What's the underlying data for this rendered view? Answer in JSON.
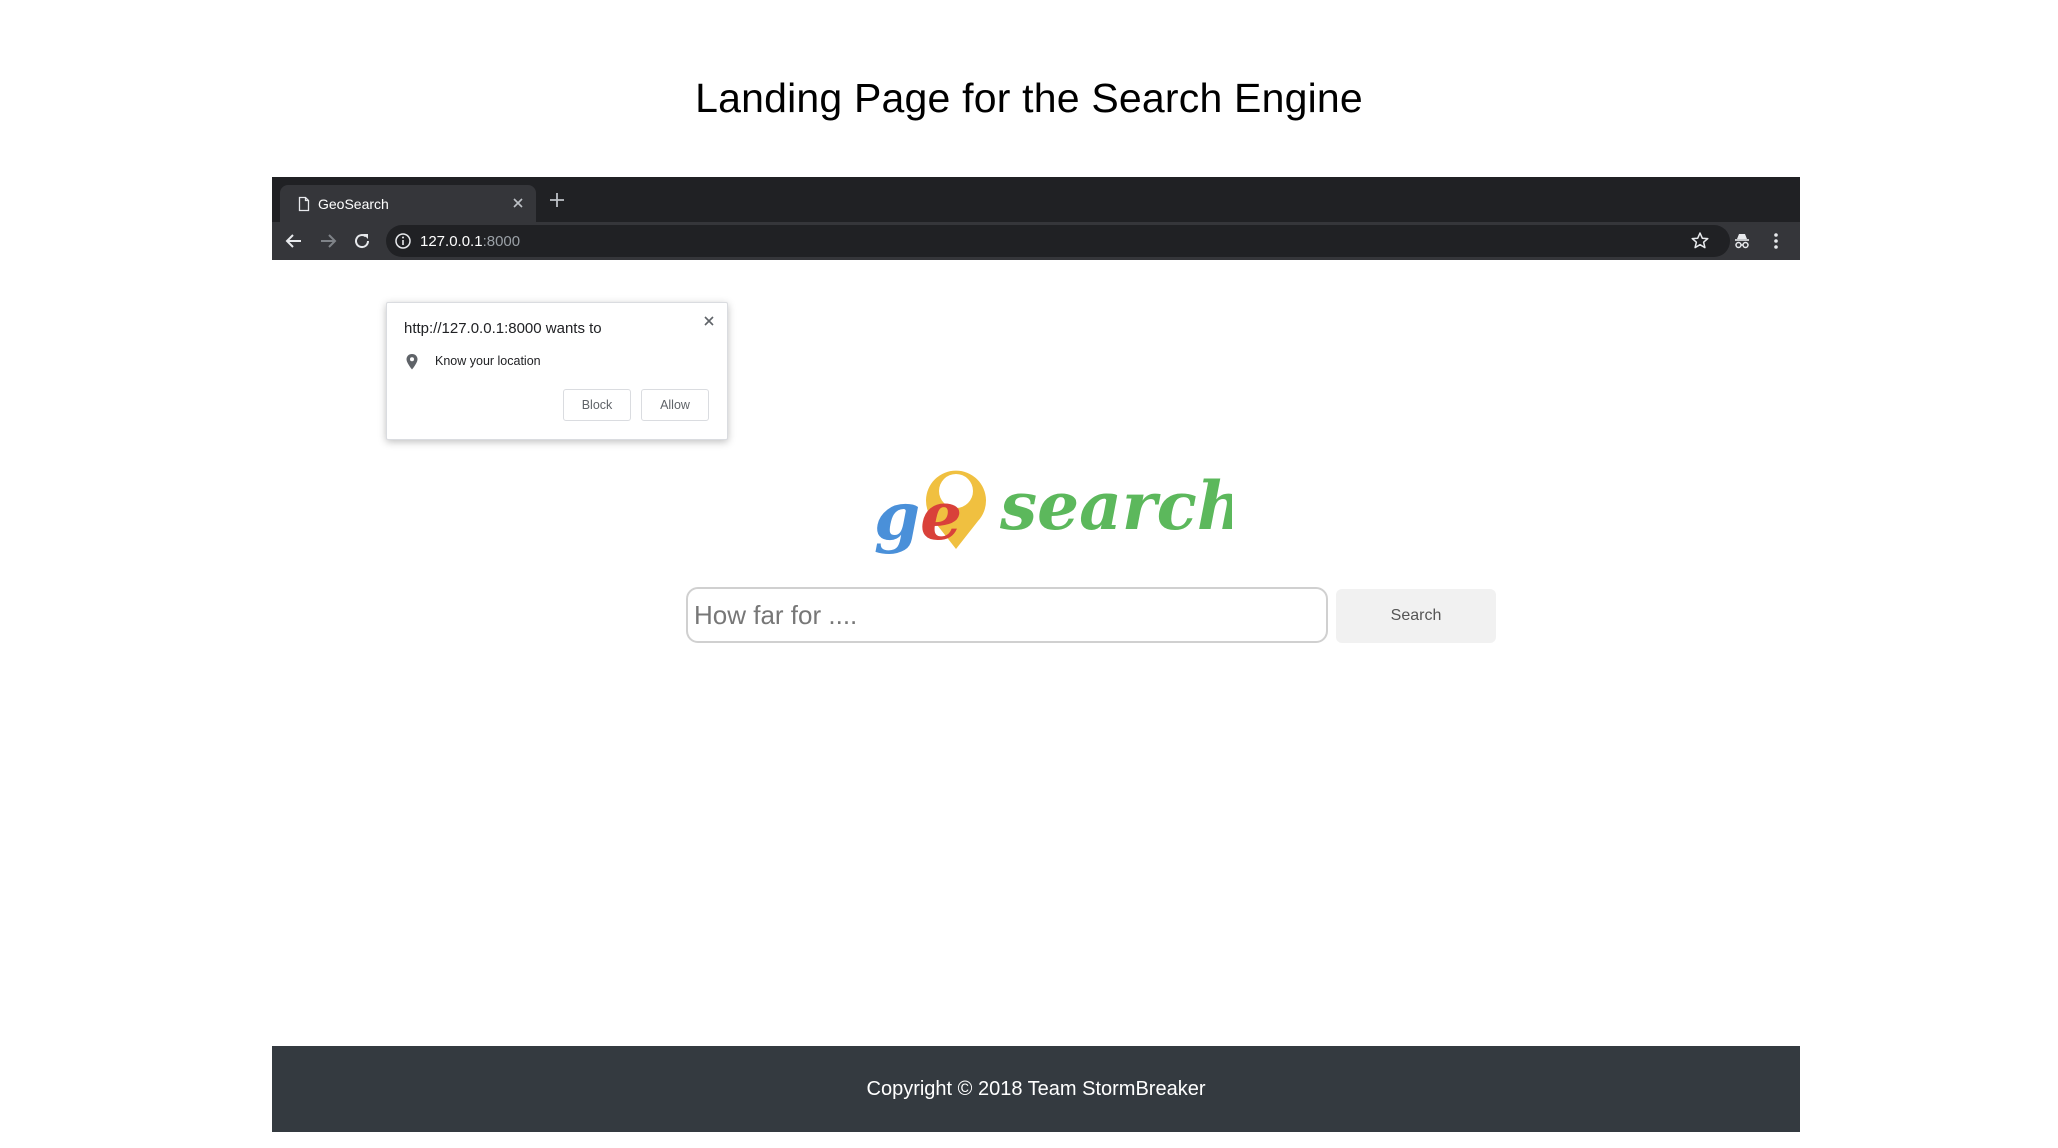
{
  "slide": {
    "title": "Landing Page for the Search Engine"
  },
  "browser": {
    "tab_title": "GeoSearch",
    "url_host": "127.0.0.1",
    "url_port": ":8000",
    "icons": [
      "page-icon",
      "close-icon",
      "plus-icon",
      "back-arrow-icon",
      "forward-arrow-icon",
      "reload-icon",
      "info-icon",
      "star-icon",
      "incognito-icon",
      "more-vert-icon"
    ]
  },
  "permission_popup": {
    "title": "http://127.0.0.1:8000 wants to",
    "item": "Know your location",
    "block_label": "Block",
    "allow_label": "Allow"
  },
  "logo": {
    "part1": "ge",
    "part2": "search",
    "colors": {
      "g": "#4a90d9",
      "e": "#d9413a",
      "pin": "#f0c040",
      "search": "#5cb85c"
    }
  },
  "search": {
    "placeholder": "How far for ....",
    "button_label": "Search"
  },
  "footer": {
    "text": "Copyright © 2018  Team StormBreaker",
    "background": "#343a40"
  }
}
